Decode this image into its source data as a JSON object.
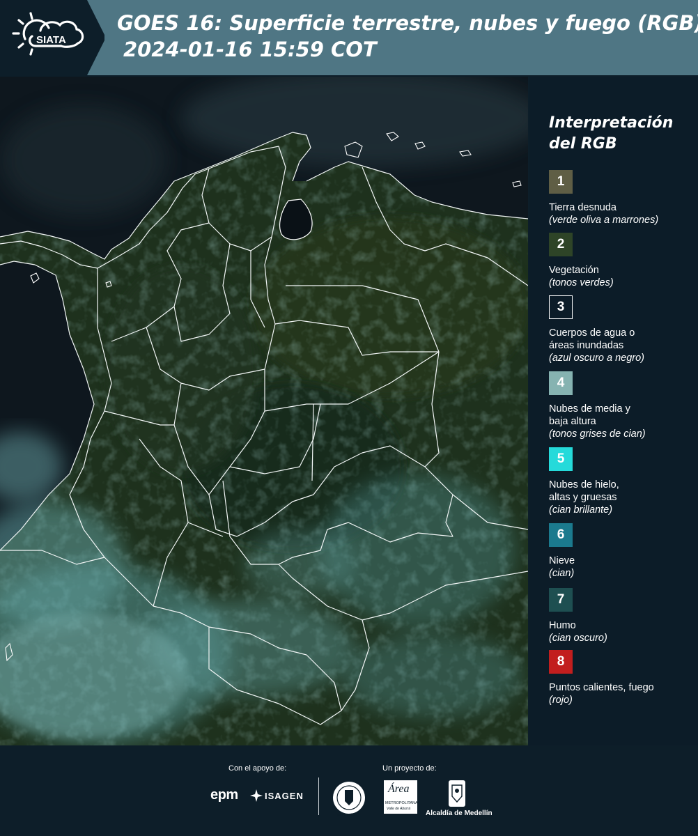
{
  "header": {
    "title_line1": "GOES 16: Superficie terrestre, nubes y fuego (RGB)",
    "title_line2": "2024-01-16 15:59 COT",
    "logo_text": "SIATA"
  },
  "legend": {
    "title_line1": "Interpretación",
    "title_line2": "del RGB",
    "items": [
      {
        "number": "1",
        "color": "#5f5e45",
        "label": [
          "Tierra desnuda"
        ],
        "desc": "(verde oliva a marrones)"
      },
      {
        "number": "2",
        "color": "#2e4427",
        "label": [
          "Vegetación"
        ],
        "desc": "(tonos verdes)"
      },
      {
        "number": "3",
        "color": "#0c1c28",
        "label": [
          "Cuerpos de agua o",
          "áreas inundadas"
        ],
        "desc": "(azul oscuro a negro)"
      },
      {
        "number": "4",
        "color": "#86b3b1",
        "label": [
          "Nubes de media y",
          "baja altura"
        ],
        "desc": "(tonos grises de cian)"
      },
      {
        "number": "5",
        "color": "#25dada",
        "label": [
          "Nubes de hielo,",
          "altas y gruesas"
        ],
        "desc": "(cian brillante)"
      },
      {
        "number": "6",
        "color": "#1b7a8e",
        "label": [
          "Nieve"
        ],
        "desc": "(cian)"
      },
      {
        "number": "7",
        "color": "#1e4f51",
        "label": [
          "Humo"
        ],
        "desc": "(cian oscuro)"
      },
      {
        "number": "8",
        "color": "#c21e1e",
        "label": [
          "Puntos calientes, fuego"
        ],
        "desc": "(rojo)"
      }
    ]
  },
  "footer": {
    "support_label": "Con el apoyo de:",
    "project_label": "Un proyecto de:",
    "epm": "epm",
    "isagen": "ISAGEN",
    "medellin_seal": "MEDELLÍN",
    "area_script": "Área",
    "area_line1": "METROPOLITANA",
    "area_line2": "Valle de Aburrá",
    "alcaldia": "Alcaldía de Medellín"
  }
}
